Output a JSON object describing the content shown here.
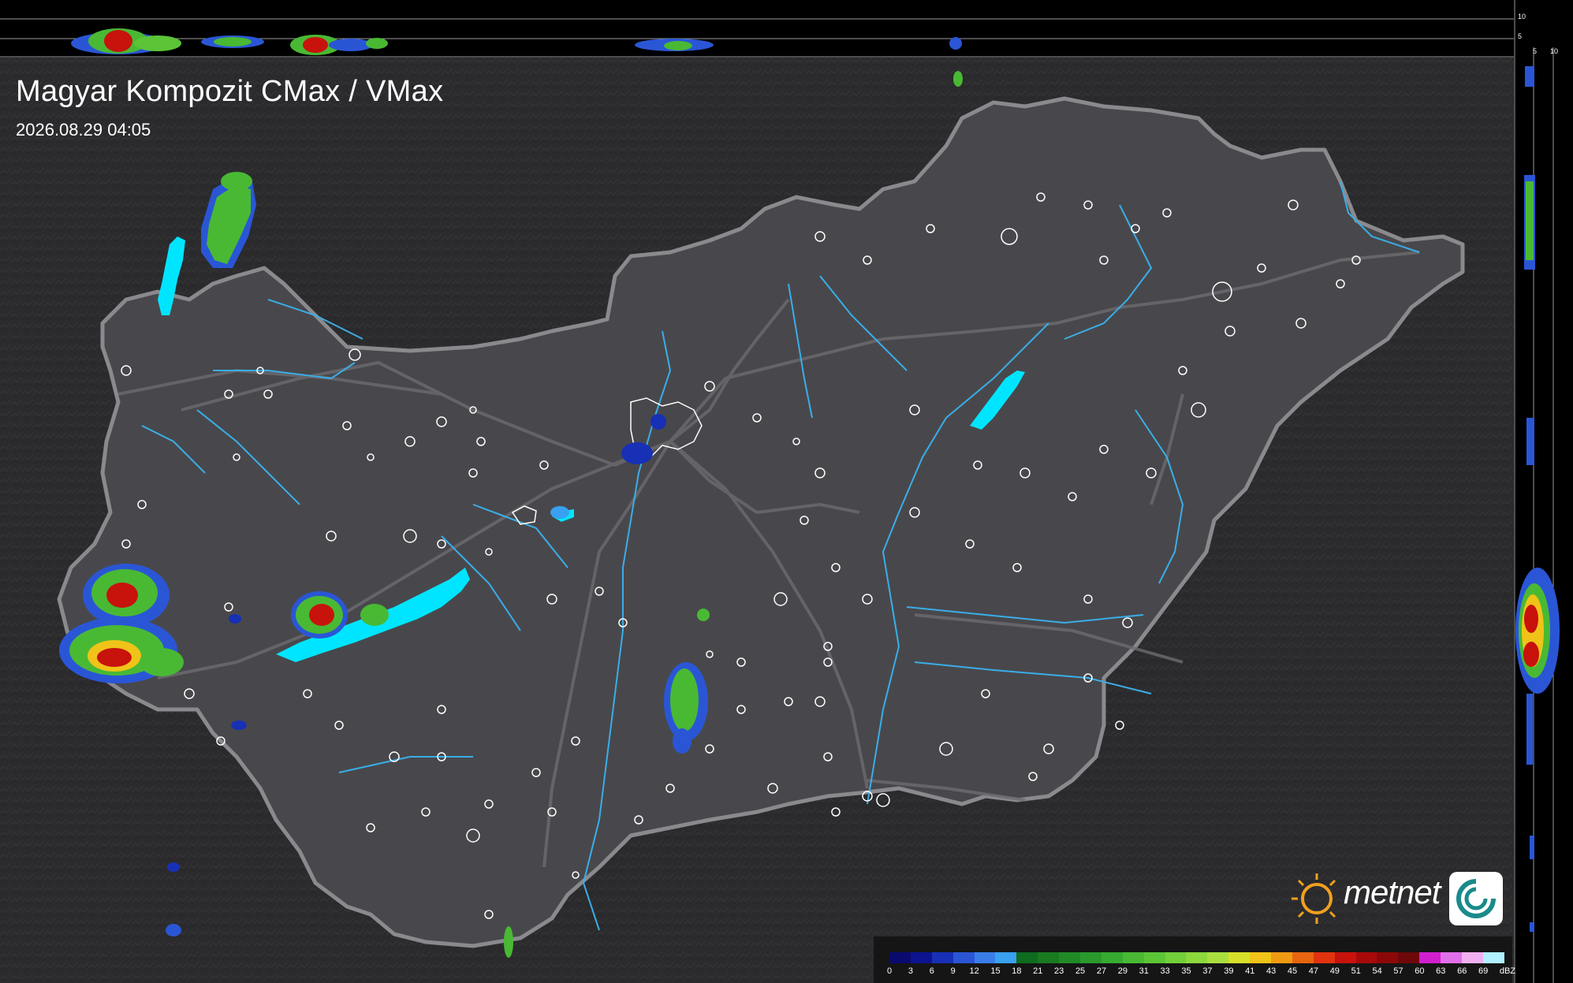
{
  "title": "Magyar Kompozit CMax / VMax",
  "timestamp": "2026.08.29 04:05",
  "brand": {
    "name": "metnet"
  },
  "legend": {
    "unit": "dBZ",
    "values": [
      "0",
      "3",
      "6",
      "9",
      "12",
      "15",
      "18",
      "21",
      "23",
      "25",
      "27",
      "29",
      "31",
      "33",
      "35",
      "37",
      "39",
      "41",
      "43",
      "45",
      "47",
      "49",
      "51",
      "54",
      "57",
      "60",
      "63",
      "66",
      "69"
    ],
    "colors": [
      "#0a0a6e",
      "#0c1390",
      "#1730b5",
      "#2a56d6",
      "#3a7de8",
      "#3aa0f0",
      "#0f6b1e",
      "#197a20",
      "#218a26",
      "#2a9a2c",
      "#37aa30",
      "#49b934",
      "#5cc437",
      "#72d03a",
      "#8cd83d",
      "#a8df3f",
      "#d6df2a",
      "#f0c318",
      "#f09a12",
      "#e8650f",
      "#e0330e",
      "#c8120c",
      "#a80a0a",
      "#8c0808",
      "#6e0808",
      "#d11fd0",
      "#e070e8",
      "#f0b0f0",
      "#b0f0ff"
    ]
  },
  "profile_axes": {
    "top_ticks": [
      "10",
      "5"
    ],
    "side_ticks": [
      "5",
      "10"
    ]
  },
  "colors": {
    "background": "#2a2a2c",
    "country_fill": "#48484c",
    "border": "#8a8a8e",
    "river": "#3aaee8",
    "lake": "#00e5ff",
    "town_outline": "#ffffff"
  }
}
